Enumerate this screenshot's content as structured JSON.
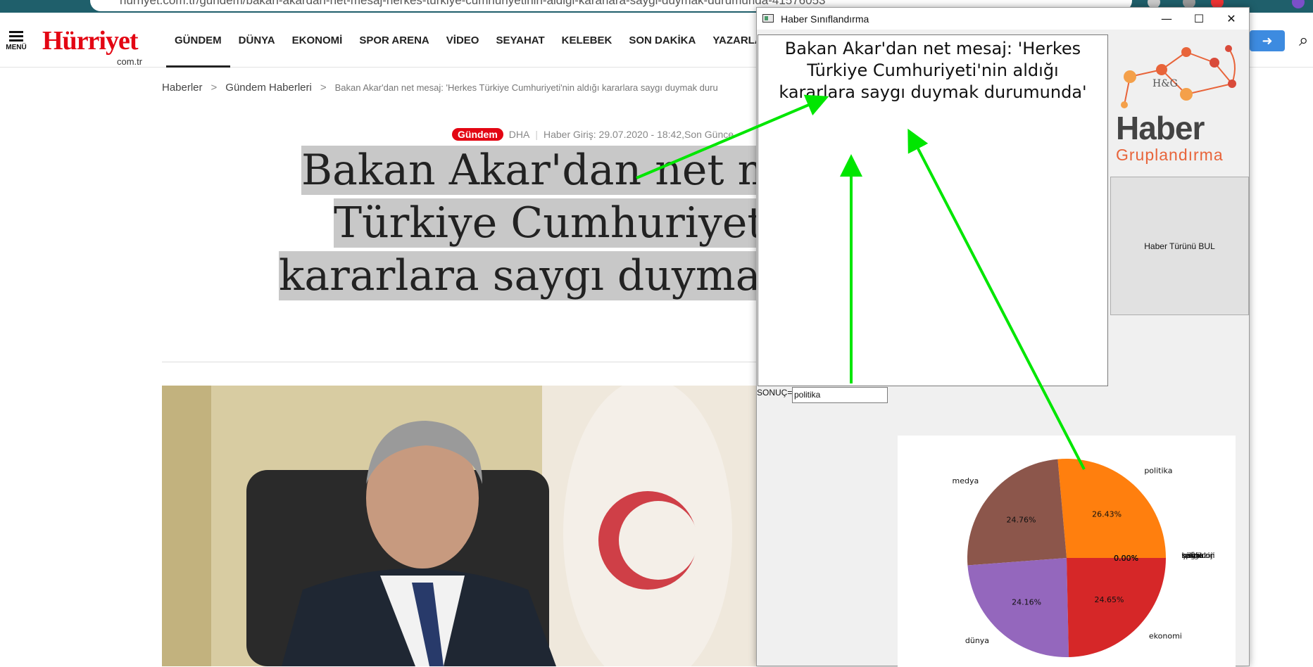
{
  "browser": {
    "url": "hurriyet.com.tr/gundem/bakan-akardan-net-mesaj-herkes-turkiye-cumhuriyetinin-aldigi-kararlara-saygi-duymak-durumunda-41576053"
  },
  "site": {
    "menu_label": "MENÜ",
    "logo_main": "Hürriyet",
    "logo_sub": "com.tr",
    "nav": [
      "GÜNDEM",
      "DÜNYA",
      "EKONOMİ",
      "SPOR ARENA",
      "VİDEO",
      "SEYAHAT",
      "KELEBEK",
      "SON DAKİKA",
      "YAZARLA"
    ],
    "login_icon": "➜",
    "search_icon": "⌕"
  },
  "article": {
    "breadcrumb": [
      "Haberler",
      "Gündem Haberleri",
      "Bakan Akar'dan net mesaj: 'Herkes Türkiye Cumhuriyeti'nin aldığı kararlara saygı duymak duru"
    ],
    "category": "Gündem",
    "source": "DHA",
    "published": "Haber Giriş: 29.07.2020 - 18:42,Son Günce",
    "headline_lines": [
      "Bakan Akar'dan net m",
      "Türkiye Cumhuriyet",
      "kararlara saygı duymal"
    ]
  },
  "app": {
    "window_title": "Haber Sınıflandırma",
    "controls": {
      "minimize": "—",
      "maximize": "☐",
      "close": "✕"
    },
    "input_text": "Bakan Akar'dan net mesaj: 'Herkes Türkiye Cumhuriyeti'nin aldığı kararlara saygı duymak durumunda'",
    "brand_title": "Haber",
    "brand_subtitle": "Gruplandırma",
    "brand_mark": "H&G",
    "find_button": "Haber Türünü BUL",
    "result_label": "SONUÇ=",
    "result_value": "politika"
  },
  "chart_data": {
    "type": "pie",
    "categories": [
      "politika",
      "medya",
      "dünya",
      "ekonomi",
      "çevre",
      "kültür",
      "sağlık",
      "spor",
      "teknoloji",
      "magazin"
    ],
    "values": [
      26.43,
      24.76,
      24.16,
      24.65,
      0.0,
      0.0,
      0.0,
      0.0,
      0.0,
      0.0
    ],
    "value_labels": [
      "26.43%",
      "24.76%",
      "24.16%",
      "24.65%",
      "0.00%",
      "0.00%",
      "0.00%",
      "0.00%",
      "0.00%",
      "0.00%"
    ],
    "colors": [
      "#ff7f0e",
      "#8c564b",
      "#9467bd",
      "#d62728",
      "#2ca02c",
      "#1f77b4",
      "#e377c2",
      "#7f7f7f",
      "#bcbd22",
      "#17becf"
    ],
    "title": "",
    "xlabel": "",
    "ylabel": ""
  },
  "colors": {
    "brand_red": "#e30613",
    "arrow_green": "#00e600",
    "login_blue": "#3d8be0"
  }
}
